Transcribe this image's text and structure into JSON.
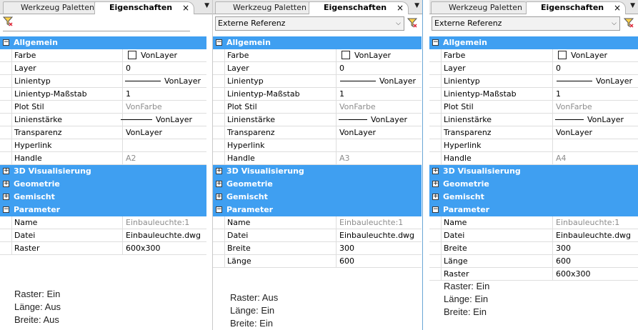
{
  "tabs": {
    "palettes": "Werkzeug Paletten",
    "properties": "Eigenschaften",
    "close": "×",
    "menu": "▼"
  },
  "dropdown_value": "Externe Referenz",
  "dropdown_arrow": "⌵",
  "icons": {
    "filter": "filter-select-icon",
    "expand": "plus-box-icon",
    "collapse": "minus-box-icon"
  },
  "colors": {
    "category_bg": "#3f9ff1",
    "category_text": "#ffffff"
  },
  "categories": {
    "general": "Allgemein",
    "viz3d": "3D Visualisierung",
    "geometry": "Geometrie",
    "mixed": "Gemischt",
    "parameters": "Parameter"
  },
  "labels": {
    "color": "Farbe",
    "layer": "Layer",
    "linetype": "Linientyp",
    "linetype_scale": "Linientyp-Maßstab",
    "plot_style": "Plot Stil",
    "lineweight": "Linienstärke",
    "transparency": "Transparenz",
    "hyperlink": "Hyperlink",
    "handle": "Handle",
    "name": "Name",
    "file": "Datei",
    "raster": "Raster",
    "breite": "Breite",
    "laenge": "Länge"
  },
  "values": {
    "color": "VonLayer",
    "layer": "0",
    "linetype": "VonLayer",
    "linetype_scale": "1",
    "plot_style": "VonFarbe",
    "lineweight": "VonLayer",
    "transparency": "VonLayer",
    "hyperlink": "",
    "name": "Einbauleuchte:1",
    "file": "Einbauleuchte.dwg"
  },
  "panels": [
    {
      "handle": "A2",
      "raster": "600x300",
      "notes": [
        "Raster: Ein",
        "Länge: Aus",
        "Breite: Aus"
      ]
    },
    {
      "handle": "A3",
      "breite": "300",
      "laenge": "600",
      "notes": [
        "Raster: Aus",
        "Länge: Ein",
        "Breite: Ein"
      ]
    },
    {
      "handle": "A4",
      "breite": "300",
      "laenge": "600",
      "raster": "600x300",
      "notes": [
        "Raster: Ein",
        "Länge: Ein",
        "Breite: Ein"
      ]
    }
  ]
}
